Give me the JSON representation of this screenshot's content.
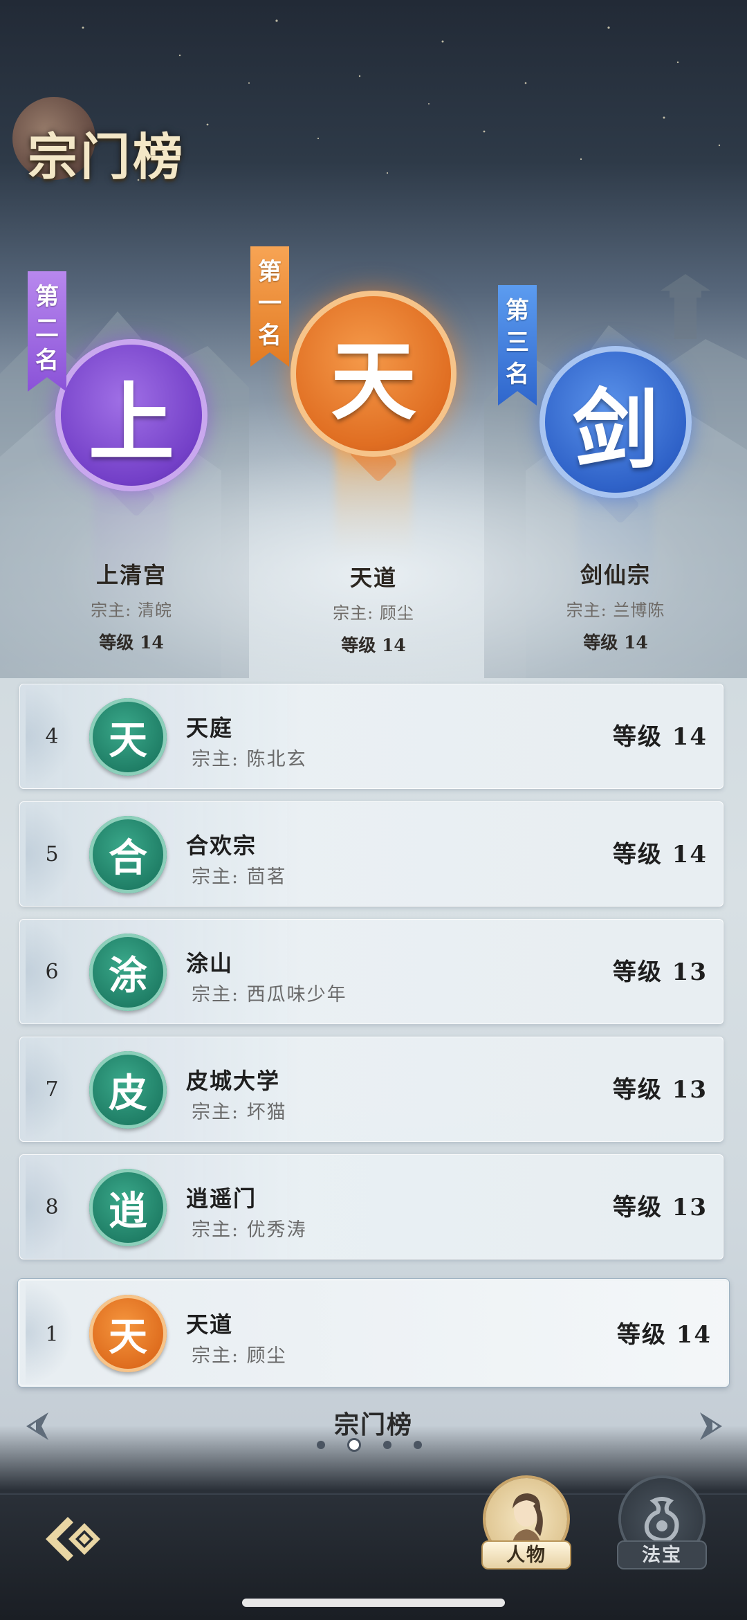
{
  "header": {
    "title": "宗门榜"
  },
  "podium": [
    {
      "position": "second",
      "banner": [
        "第",
        "二",
        "名"
      ],
      "emblem": "上",
      "name": "上清宫",
      "leader": "宗主: 清皖",
      "level": "等级 14",
      "color": "#7a45cc"
    },
    {
      "position": "first",
      "banner": [
        "第",
        "一",
        "名"
      ],
      "emblem": "天",
      "name": "天道",
      "leader": "宗主: 顾尘",
      "level": "等级 14",
      "color": "#e2741f"
    },
    {
      "position": "third",
      "banner": [
        "第",
        "三",
        "名"
      ],
      "emblem": "剑",
      "name": "剑仙宗",
      "leader": "宗主: 兰博陈",
      "level": "等级 14",
      "color": "#2f64c8"
    }
  ],
  "ranking": [
    {
      "rank": "4",
      "emblem": "天",
      "name": "天庭",
      "leader": "宗主: 陈北玄",
      "level": "等级 14"
    },
    {
      "rank": "5",
      "emblem": "合",
      "name": "合欢宗",
      "leader": "宗主: 茴茗",
      "level": "等级 14"
    },
    {
      "rank": "6",
      "emblem": "涂",
      "name": "涂山",
      "leader": "宗主: 西瓜味少年",
      "level": "等级 13"
    },
    {
      "rank": "7",
      "emblem": "皮",
      "name": "皮城大学",
      "leader": "宗主: 坏猫",
      "level": "等级 13"
    },
    {
      "rank": "8",
      "emblem": "逍",
      "name": "逍遥门",
      "leader": "宗主: 优秀涛",
      "level": "等级 13"
    }
  ],
  "my_sect": {
    "rank": "1",
    "emblem": "天",
    "name": "天道",
    "leader": "宗主: 顾尘",
    "level": "等级 14"
  },
  "footer": {
    "title": "宗门榜",
    "page_dots": 4,
    "active_dot": 2
  },
  "bottom_nav": {
    "characters_label": "人物",
    "treasures_label": "法宝"
  },
  "colors": {
    "accent_green": "#1e7c64",
    "accent_orange": "#e2741f"
  }
}
